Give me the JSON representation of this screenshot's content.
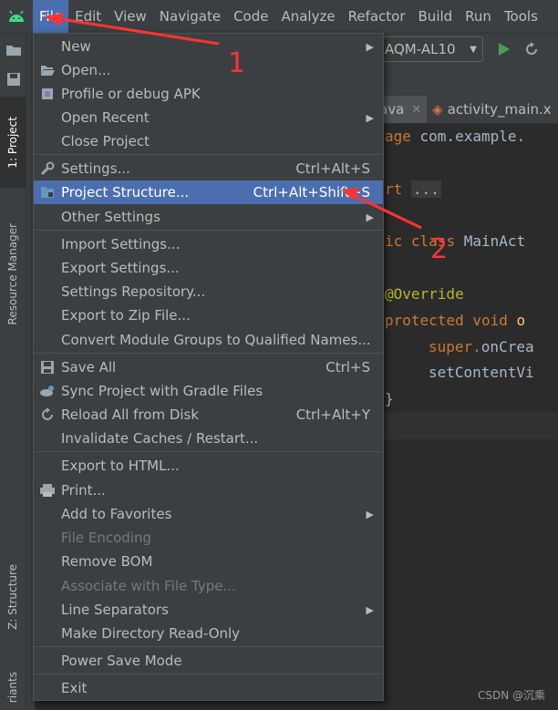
{
  "menubar": {
    "items": [
      "File",
      "Edit",
      "View",
      "Navigate",
      "Code",
      "Analyze",
      "Refactor",
      "Build",
      "Run",
      "Tools"
    ]
  },
  "toolbar": {
    "run_config": "AQM-AL10"
  },
  "side_tabs": {
    "project": "1: Project",
    "resource": "Resource Manager",
    "structure": "Z: Structure",
    "variants": "riants"
  },
  "editor": {
    "tabs": [
      {
        "label": "ava"
      },
      {
        "label": "activity_main.x"
      }
    ],
    "lines": {
      "l1a": "age ",
      "l1b": "com.example.",
      "l2a": "rt ",
      "l2b": "...",
      "l3a": "ic ",
      "l3b": "class ",
      "l3c": "MainAct",
      "l4": "@Override",
      "l5a": "protected ",
      "l5b": "void ",
      "l5c": "o",
      "l6a": "super.",
      "l6b": "onCrea",
      "l7": "setContentVi",
      "l8": "}"
    }
  },
  "menu": {
    "items": [
      {
        "label": "New",
        "shortcut": ""
      },
      {
        "label": "Open...",
        "shortcut": ""
      },
      {
        "label": "Profile or debug APK",
        "shortcut": ""
      },
      {
        "label": "Open Recent",
        "shortcut": ""
      },
      {
        "label": "Close Project",
        "shortcut": ""
      },
      {
        "label": "Settings...",
        "shortcut": "Ctrl+Alt+S"
      },
      {
        "label": "Project Structure...",
        "shortcut": "Ctrl+Alt+Shift+S"
      },
      {
        "label": "Other Settings",
        "shortcut": ""
      },
      {
        "label": "Import Settings...",
        "shortcut": ""
      },
      {
        "label": "Export Settings...",
        "shortcut": ""
      },
      {
        "label": "Settings Repository...",
        "shortcut": ""
      },
      {
        "label": "Export to Zip File...",
        "shortcut": ""
      },
      {
        "label": "Convert Module Groups to Qualified Names...",
        "shortcut": ""
      },
      {
        "label": "Save All",
        "shortcut": "Ctrl+S"
      },
      {
        "label": "Sync Project with Gradle Files",
        "shortcut": ""
      },
      {
        "label": "Reload All from Disk",
        "shortcut": "Ctrl+Alt+Y"
      },
      {
        "label": "Invalidate Caches / Restart...",
        "shortcut": ""
      },
      {
        "label": "Export to HTML...",
        "shortcut": ""
      },
      {
        "label": "Print...",
        "shortcut": ""
      },
      {
        "label": "Add to Favorites",
        "shortcut": ""
      },
      {
        "label": "File Encoding",
        "shortcut": ""
      },
      {
        "label": "Remove BOM",
        "shortcut": ""
      },
      {
        "label": "Associate with File Type...",
        "shortcut": ""
      },
      {
        "label": "Line Separators",
        "shortcut": ""
      },
      {
        "label": "Make Directory Read-Only",
        "shortcut": ""
      },
      {
        "label": "Power Save Mode",
        "shortcut": ""
      },
      {
        "label": "Exit",
        "shortcut": ""
      }
    ]
  },
  "annotations": {
    "first": "1",
    "second": "2"
  },
  "watermark": "CSDN @沉乘",
  "colors": {
    "highlight": "#4b6eaf",
    "arrow": "#ff3333",
    "background": "#2b2b2b"
  }
}
